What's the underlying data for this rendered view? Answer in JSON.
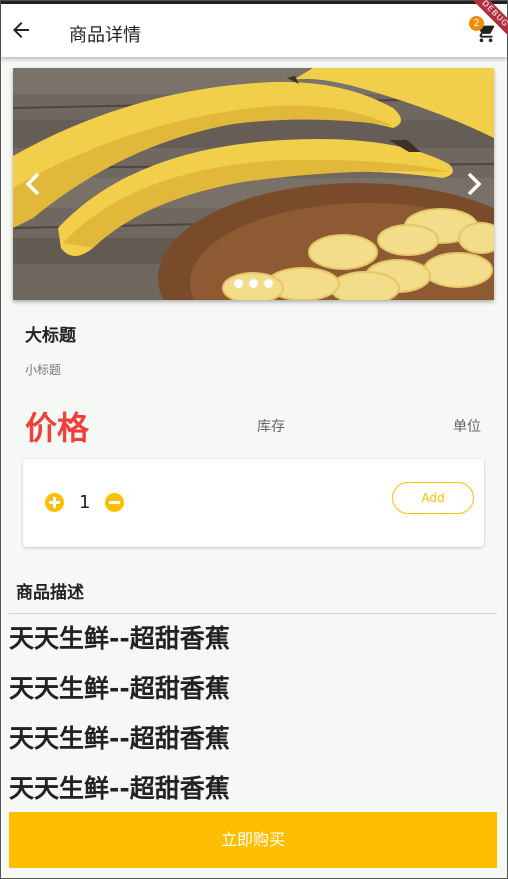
{
  "app_bar": {
    "title": "商品详情",
    "cart_count": "2",
    "debug_banner": "DEBUG"
  },
  "carousel": {
    "image": "banana-photo",
    "slide_count": 3
  },
  "product": {
    "title": "大标题",
    "subtitle": "小标题",
    "price": "价格",
    "stock": "库存",
    "unit": "单位"
  },
  "quantity": {
    "value": "1",
    "add_label": "Add"
  },
  "description": {
    "heading": "商品描述",
    "lines": [
      "天天生鲜--超甜香蕉",
      "天天生鲜--超甜香蕉",
      "天天生鲜--超甜香蕉",
      "天天生鲜--超甜香蕉"
    ]
  },
  "buy_button": {
    "label": "立即购买"
  },
  "colors": {
    "accent": "#ffbf00",
    "price": "#f0403c",
    "badge": "#f08c00",
    "background": "#f5f8f5"
  },
  "icons": [
    "arrow-left-icon",
    "shopping-cart-icon",
    "chevron-left-icon",
    "chevron-right-icon",
    "plus-circle-icon",
    "minus-circle-icon"
  ]
}
